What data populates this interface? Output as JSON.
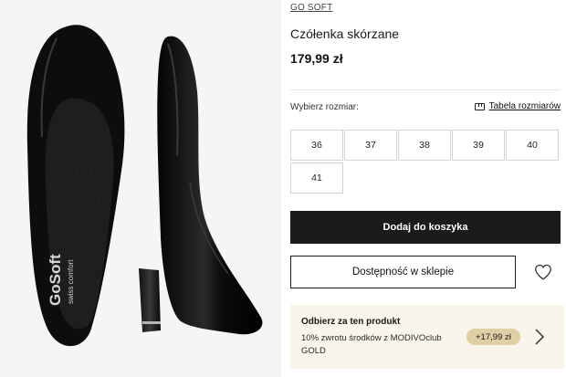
{
  "product": {
    "brand": "GO SOFT",
    "name": "Czółenka skórzane",
    "price": "179,99 zł"
  },
  "insole": {
    "logo": "GoSoft",
    "tagline": "swiss comfort"
  },
  "size_selector": {
    "label": "Wybierz rozmiar:",
    "size_table_link": "Tabela rozmiarów",
    "sizes": [
      "36",
      "37",
      "38",
      "39",
      "40",
      "41"
    ]
  },
  "actions": {
    "add_to_cart": "Dodaj do koszyka",
    "store_availability": "Dostępność w sklepie"
  },
  "loyalty": {
    "title": "Odbierz za ten produkt",
    "description": "10% zwrotu środków z MODIVOclub GOLD",
    "badge": "+17,99 zł",
    "background_color": "#faf5ea",
    "badge_color": "#dfcfa4"
  },
  "icons": [
    "ruler-icon",
    "heart-icon",
    "chevron-right-icon"
  ],
  "colors": {
    "primary_button": "#1b1b1b",
    "gallery_background": "#f5f5f5"
  }
}
